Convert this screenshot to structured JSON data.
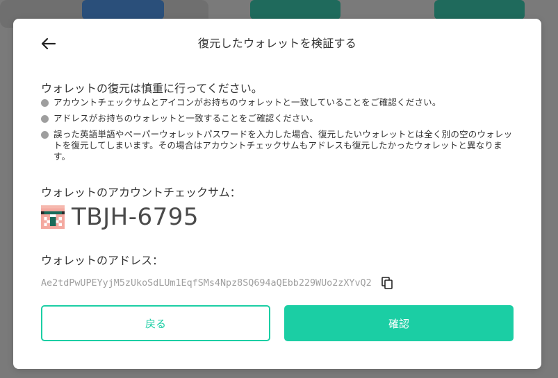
{
  "modal": {
    "title": "復元したウォレットを検証する",
    "warning_heading": "ウォレットの復元は慎重に行ってください。",
    "warnings": [
      "アカウントチェックサムとアイコンがお持ちのウォレットと一致していることをご確認ください。",
      "アドレスがお持ちのウォレットと一致することをご確認ください。",
      "誤った英語単語やペーパーウォレットパスワードを入力した場合、復元したいウォレットとは全く別の空のウォレットを復元してしまいます。その場合はアカウントチェックサムもアドレスも復元したかったウォレットと異なります。"
    ],
    "checksum_label": "ウォレットのアカウントチェックサム：",
    "checksum_value": "TBJH-6795",
    "address_label": "ウォレットのアドレス：",
    "address_value": "Ae2tdPwUPEYyjM5zUkoSdLUm1EqfSMs4Npz8SQ694aQEbb229WUo2zXYvQ2",
    "back_button": "戻る",
    "confirm_button": "確認"
  },
  "icons": {
    "back": "arrow-left-icon",
    "copy": "copy-icon",
    "bullet": "bullet-dot"
  },
  "colors": {
    "accent": "#1bcea4",
    "overlay": "#7b7b7b",
    "text": "#333333",
    "muted": "#a0a0a0"
  }
}
